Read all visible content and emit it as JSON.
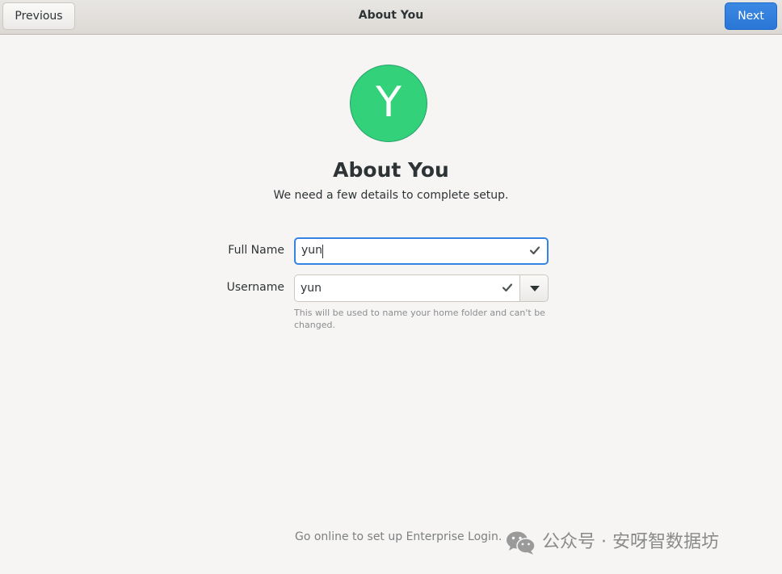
{
  "header": {
    "title": "About You",
    "previous_label": "Previous",
    "next_label": "Next",
    "next_color": "#3584e4"
  },
  "avatar": {
    "letter": "Y",
    "color": "#33d17a"
  },
  "page": {
    "title": "About You",
    "subtitle": "We need a few details to complete setup."
  },
  "form": {
    "full_name": {
      "label": "Full Name",
      "value": "yun",
      "valid_icon": "checkmark-icon"
    },
    "username": {
      "label": "Username",
      "value": "yun",
      "valid_icon": "checkmark-icon",
      "dropdown_icon": "caret-down-icon",
      "hint": "This will be used to name your home folder and can't be changed."
    }
  },
  "footer": {
    "enterprise_login": "Go online to set up Enterprise Login."
  },
  "watermark": {
    "icon": "wechat-icon",
    "text": "公众号 · 安呀智数据坊"
  }
}
